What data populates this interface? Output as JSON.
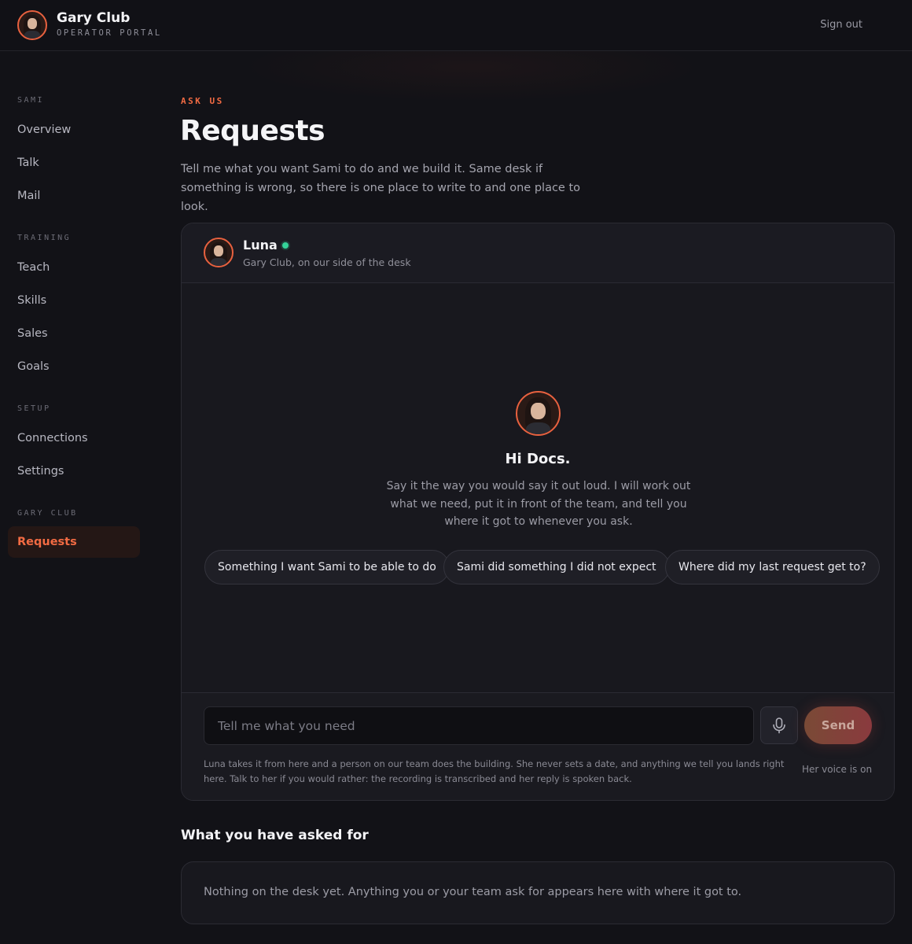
{
  "brand": {
    "title": "Gary Club",
    "subtitle": "OPERATOR PORTAL"
  },
  "header": {
    "signout_label": "Sign out"
  },
  "sidebar": {
    "sections": [
      {
        "label": "SAMI",
        "items": [
          "Overview",
          "Talk",
          "Mail"
        ]
      },
      {
        "label": "TRAINING",
        "items": [
          "Teach",
          "Skills",
          "Sales",
          "Goals"
        ]
      },
      {
        "label": "SETUP",
        "items": [
          "Connections",
          "Settings"
        ]
      },
      {
        "label": "GARY CLUB",
        "items": [
          "Requests"
        ]
      }
    ],
    "active_item": "Requests"
  },
  "page": {
    "eyebrow": "ASK US",
    "title": "Requests",
    "description": "Tell me what you want Sami to do and we build it. Same desk if something is wrong, so there is one place to write to and one place to look."
  },
  "chat": {
    "agent_name": "Luna",
    "agent_status": "online",
    "agent_subtitle": "Gary Club, on our side of the desk",
    "greeting": "Hi Docs.",
    "intro": "Say it the way you would say it out loud. I will work out what we need, put it in front of the team, and tell you where it got to whenever you ask.",
    "suggestions": [
      "Something I want Sami to be able to do",
      "Sami did something I did not expect",
      "Where did my last request get to?"
    ],
    "input_placeholder": "Tell me what you need",
    "input_value": "",
    "send_label": "Send",
    "mic_icon": "microphone-icon",
    "help_text": "Luna takes it from here and a person on our team does the building. She never sets a date, and anything we tell you lands right here. Talk to her if you would rather: the recording is transcribed and her reply is spoken back.",
    "voice_status": "Her voice is on"
  },
  "requests": {
    "title": "What you have asked for",
    "empty_text": "Nothing on the desk yet. Anything you or your team ask for appears here with where it got to."
  },
  "colors": {
    "accent": "#f26b43",
    "background": "#121217",
    "card": "#18181e",
    "online": "#34d399"
  }
}
